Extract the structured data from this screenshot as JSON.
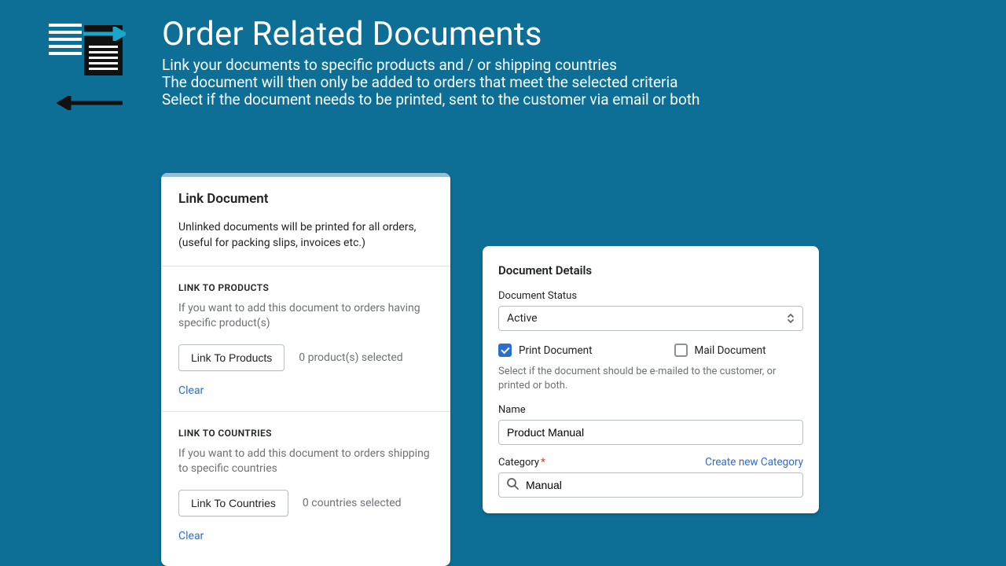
{
  "header": {
    "title": "Order Related Documents",
    "sub1": "Link your documents to specific products and / or shipping countries",
    "sub2": "The document will then only be added to orders that meet the selected criteria",
    "sub3": "Select if the document needs to be printed, sent to the customer via email or both"
  },
  "link_card": {
    "title": "Link Document",
    "intro": "Unlinked documents will be printed for all orders, (useful for packing slips, invoices etc.)",
    "products": {
      "heading": "LINK TO PRODUCTS",
      "desc": "If you want to add this document to orders having specific product(s)",
      "button": "Link To Products",
      "status": "0 product(s) selected",
      "clear": "Clear"
    },
    "countries": {
      "heading": "LINK TO COUNTRIES",
      "desc": "If you want to add this document to orders shipping to specific countries",
      "button": "Link To Countries",
      "status": "0 countries selected",
      "clear": "Clear"
    }
  },
  "details": {
    "title": "Document Details",
    "status_label": "Document Status",
    "status_value": "Active",
    "print_label": "Print Document",
    "mail_label": "Mail Document",
    "help": "Select if the document should be e-mailed to the customer, or printed or both.",
    "name_label": "Name",
    "name_value": "Product Manual",
    "category_label": "Category",
    "create_category": "Create new Category",
    "category_value": "Manual"
  }
}
